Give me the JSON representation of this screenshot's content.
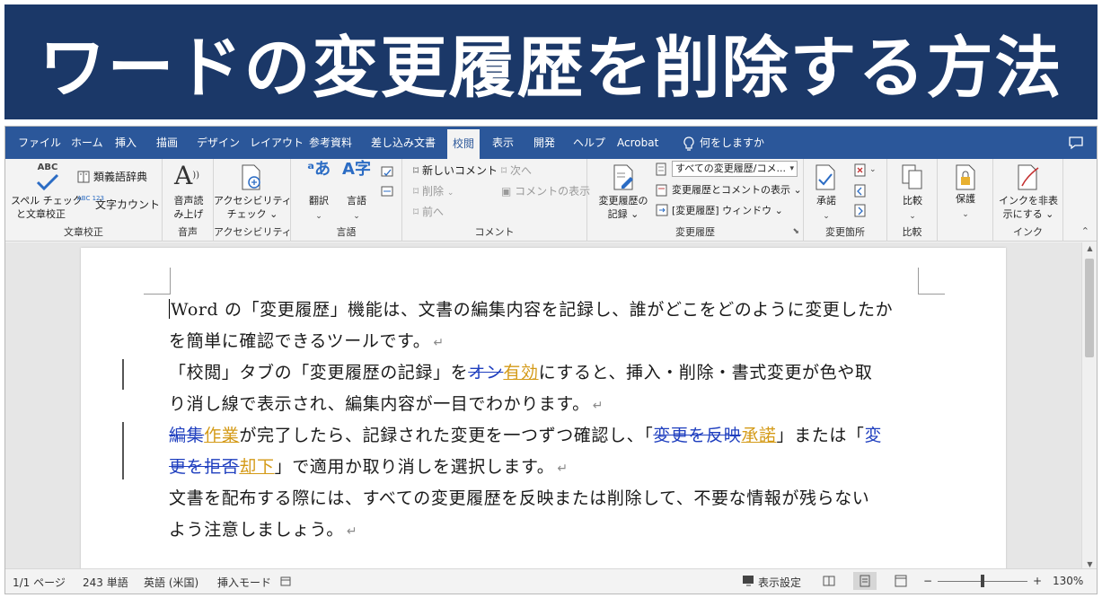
{
  "banner": {
    "title": "ワードの変更履歴を削除する方法"
  },
  "tabs": [
    {
      "label": "ファイル"
    },
    {
      "label": "ホーム"
    },
    {
      "label": "挿入"
    },
    {
      "label": "描画"
    },
    {
      "label": "デザイン"
    },
    {
      "label": "レイアウト"
    },
    {
      "label": "参考資料"
    },
    {
      "label": "差し込み文書"
    },
    {
      "label": "校閲",
      "active": true
    },
    {
      "label": "表示"
    },
    {
      "label": "開発"
    },
    {
      "label": "ヘルプ"
    },
    {
      "label": "Acrobat"
    }
  ],
  "tellme": {
    "label": "何をしますか",
    "icon": "lightbulb-icon"
  },
  "ribbon": {
    "proofing": {
      "label": "文章校正",
      "spell_line1": "スペル チェック",
      "spell_line2": "と文章校正",
      "spell_icon_text": "ABC",
      "thesaurus": "類義語辞典",
      "wordcount": "文字カウント",
      "wordcount_icon_text": "ABC 123"
    },
    "speech": {
      "label": "音声",
      "read_line1": "音声読",
      "read_line2": "み上げ"
    },
    "accessibility": {
      "label": "アクセシビリティ",
      "check_line1": "アクセシビリティ",
      "check_line2": "チェック ⌄"
    },
    "language": {
      "label": "言語",
      "translate": "翻訳",
      "language_btn": "言語"
    },
    "comments": {
      "label": "コメント",
      "new": "新しいコメント",
      "delete": "削除",
      "previous": "前へ",
      "next": "次へ",
      "show": "コメントの表示"
    },
    "tracking": {
      "label": "変更履歴",
      "track_line1": "変更履歴の",
      "track_line2": "記録 ⌄",
      "markup_select": "すべての変更履歴/コメ...",
      "show_markup": "変更履歴とコメントの表示 ⌄",
      "pane": "[変更履歴] ウィンドウ ⌄"
    },
    "changes": {
      "label": "変更箇所",
      "accept": "承諾"
    },
    "compare": {
      "label": "比較",
      "compare_btn": "比較"
    },
    "protect": {
      "label": "",
      "protect_btn": "保護"
    },
    "ink": {
      "label": "インク",
      "hide_line1": "インクを非表",
      "hide_line2": "示にする ⌄"
    }
  },
  "document": {
    "p1_line1": "Word の「変更履歴」機能は、文書の編集内容を記録し、誰がどこをどのように変更したか",
    "p1_line2": "を簡単に確認できるツールです。",
    "p2_a": "「校閲」タブの「変更履歴の記録」を",
    "p2_del": "オン",
    "p2_ins": "有効",
    "p2_b": "にすると、挿入・削除・書式変更が色や取",
    "p2_line2": "り消し線で表示され、編集内容が一目でわかります。",
    "p3_del1": "編集",
    "p3_ins1": "作業",
    "p3_a": "が完了したら、記録された変更を一つずつ確認し、「",
    "p3_del2": "変更を反映",
    "p3_ins2": "承諾",
    "p3_b": "」または「",
    "p3_del3a": "変",
    "p3_del3b": "更を拒否",
    "p3_ins3": "却下",
    "p3_c": "」で適用か取り消しを選択します。",
    "p4_line1": "文書を配布する際には、すべての変更履歴を反映または削除して、不要な情報が残らない",
    "p4_line2": "よう注意しましょう。",
    "para_mark": "↵"
  },
  "status": {
    "page": "1/1 ページ",
    "words": "243 単語",
    "lang": "英語 (米国)",
    "mode": "挿入モード",
    "display_settings": "表示設定",
    "zoom_minus": "−",
    "zoom_plus": "+",
    "zoom": "130%"
  }
}
